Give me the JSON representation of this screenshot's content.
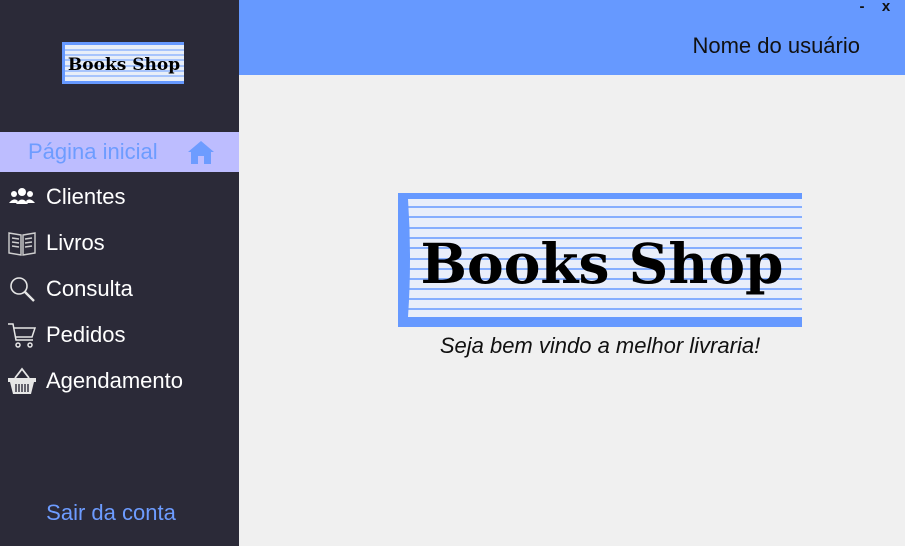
{
  "app": {
    "logo_text": "Books Shop"
  },
  "sidebar": {
    "active_item": {
      "label": "Página inicial",
      "icon": "home-icon"
    },
    "items": [
      {
        "label": "Clientes",
        "icon": "users-icon"
      },
      {
        "label": "Livros",
        "icon": "book-icon"
      },
      {
        "label": "Consulta",
        "icon": "search-icon"
      },
      {
        "label": "Pedidos",
        "icon": "cart-icon"
      },
      {
        "label": "Agendamento",
        "icon": "basket-icon"
      }
    ],
    "logout_label": "Sair da conta"
  },
  "header": {
    "username": "Nome do usuário",
    "minimize_label": "-",
    "close_label": "x"
  },
  "main": {
    "welcome_text": "Seja bem vindo a melhor livraria!"
  },
  "colors": {
    "sidebar_bg": "#2b2a38",
    "header_bg": "#6699ff",
    "active_bg": "#bdbdff",
    "accent": "#6d9cff",
    "content_bg": "#f0f0f0"
  }
}
